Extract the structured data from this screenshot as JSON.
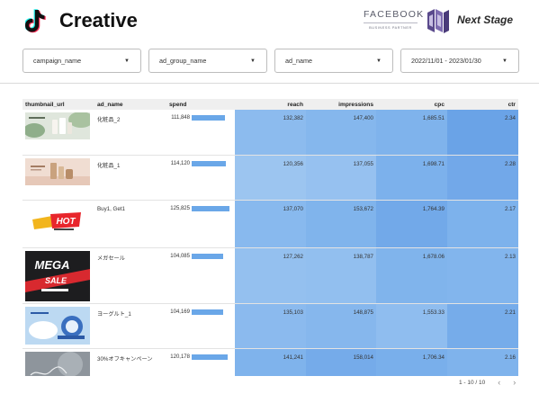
{
  "header": {
    "title": "Creative",
    "fb_word": "FACEBOOK",
    "fb_sub": "BUSINESS PARTNER",
    "ns_text": "Next Stage"
  },
  "filters": [
    {
      "label": "campaign_name"
    },
    {
      "label": "ad_group_name"
    },
    {
      "label": "ad_name"
    },
    {
      "label": "2022/11/01 - 2023/01/30"
    }
  ],
  "table": {
    "columns": [
      "thumbnail_url",
      "ad_name",
      "spend",
      "reach",
      "impressions",
      "cpc",
      "ctr"
    ],
    "rows": [
      {
        "ad_name": "化粧品_2",
        "spend": "111,848",
        "spend_frac": 0.889,
        "reach": "132,382",
        "impressions": "147,400",
        "cpc": "1,685.51",
        "ctr": "2.34",
        "thumb": "cosmetic-green"
      },
      {
        "ad_name": "化粧品_1",
        "spend": "114,120",
        "spend_frac": 0.907,
        "reach": "120,356",
        "impressions": "137,055",
        "cpc": "1,698.71",
        "ctr": "2.28",
        "thumb": "cosmetic-beige"
      },
      {
        "ad_name": "Buy1, Get1",
        "spend": "125,825",
        "spend_frac": 1.0,
        "reach": "137,070",
        "impressions": "153,672",
        "cpc": "1,764.39",
        "ctr": "2.17",
        "thumb": "hot-banner"
      },
      {
        "ad_name": "メガセール",
        "spend": "104,085",
        "spend_frac": 0.827,
        "reach": "127,262",
        "impressions": "138,787",
        "cpc": "1,678.06",
        "ctr": "2.13",
        "thumb": "mega-sale"
      },
      {
        "ad_name": "ヨーグルト_1",
        "spend": "104,169",
        "spend_frac": 0.828,
        "reach": "135,103",
        "impressions": "148,875",
        "cpc": "1,553.33",
        "ctr": "2.21",
        "thumb": "yogurt"
      },
      {
        "ad_name": "30%オフキャンペーン",
        "spend": "120,178",
        "spend_frac": 0.955,
        "reach": "141,241",
        "impressions": "158,014",
        "cpc": "1,706.34",
        "ctr": "2.16",
        "thumb": "grey-photo"
      }
    ]
  },
  "pager": {
    "range": "1 - 10 / 10",
    "prev": "‹",
    "next": "›"
  },
  "colors": {
    "accent": "#6aa7e8",
    "heat_base": "#7eb3ec",
    "heat_high": "#6aa3e7"
  }
}
